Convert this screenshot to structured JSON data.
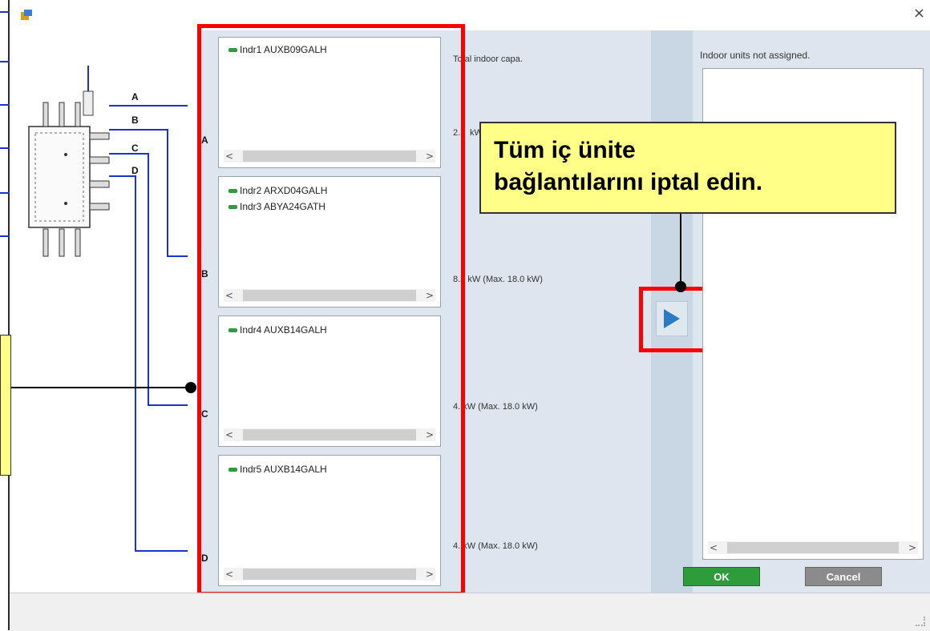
{
  "window": {
    "close_glyph": "×",
    "app_icon": "app-icon"
  },
  "diagram": {
    "port_letters": [
      "A",
      "B",
      "C",
      "D"
    ]
  },
  "branches": [
    {
      "letter": "A",
      "units": [
        "Indr1 AUXB09GALH"
      ],
      "capacity": "2.",
      "capacity_suffix": "kW"
    },
    {
      "letter": "B",
      "units": [
        "Indr2 ARXD04GALH",
        "Indr3 ABYA24GATH"
      ],
      "capacity": "8.2 kW (Max. 18.0 kW)"
    },
    {
      "letter": "C",
      "units": [
        "Indr4 AUXB14GALH"
      ],
      "capacity": "4.  kW (Max. 18.0 kW)"
    },
    {
      "letter": "D",
      "units": [
        "Indr5 AUXB14GALH"
      ],
      "capacity": "4.  kW (Max. 18.0 kW)"
    }
  ],
  "total_capa_label": "Total indoor capa.",
  "unassigned_label": "Indoor units not assigned.",
  "scroll_left": "<",
  "scroll_right": ">",
  "ok_label": "OK",
  "cancel_label": "Cancel",
  "callout_text_line1": "Tüm iç ünite",
  "callout_text_line2": "bağlantılarını iptal edin.",
  "colors": {
    "highlight": "#ff0000",
    "callout": "#ffff88",
    "wire": "#1a33cc",
    "ok": "#2e9c3a"
  }
}
